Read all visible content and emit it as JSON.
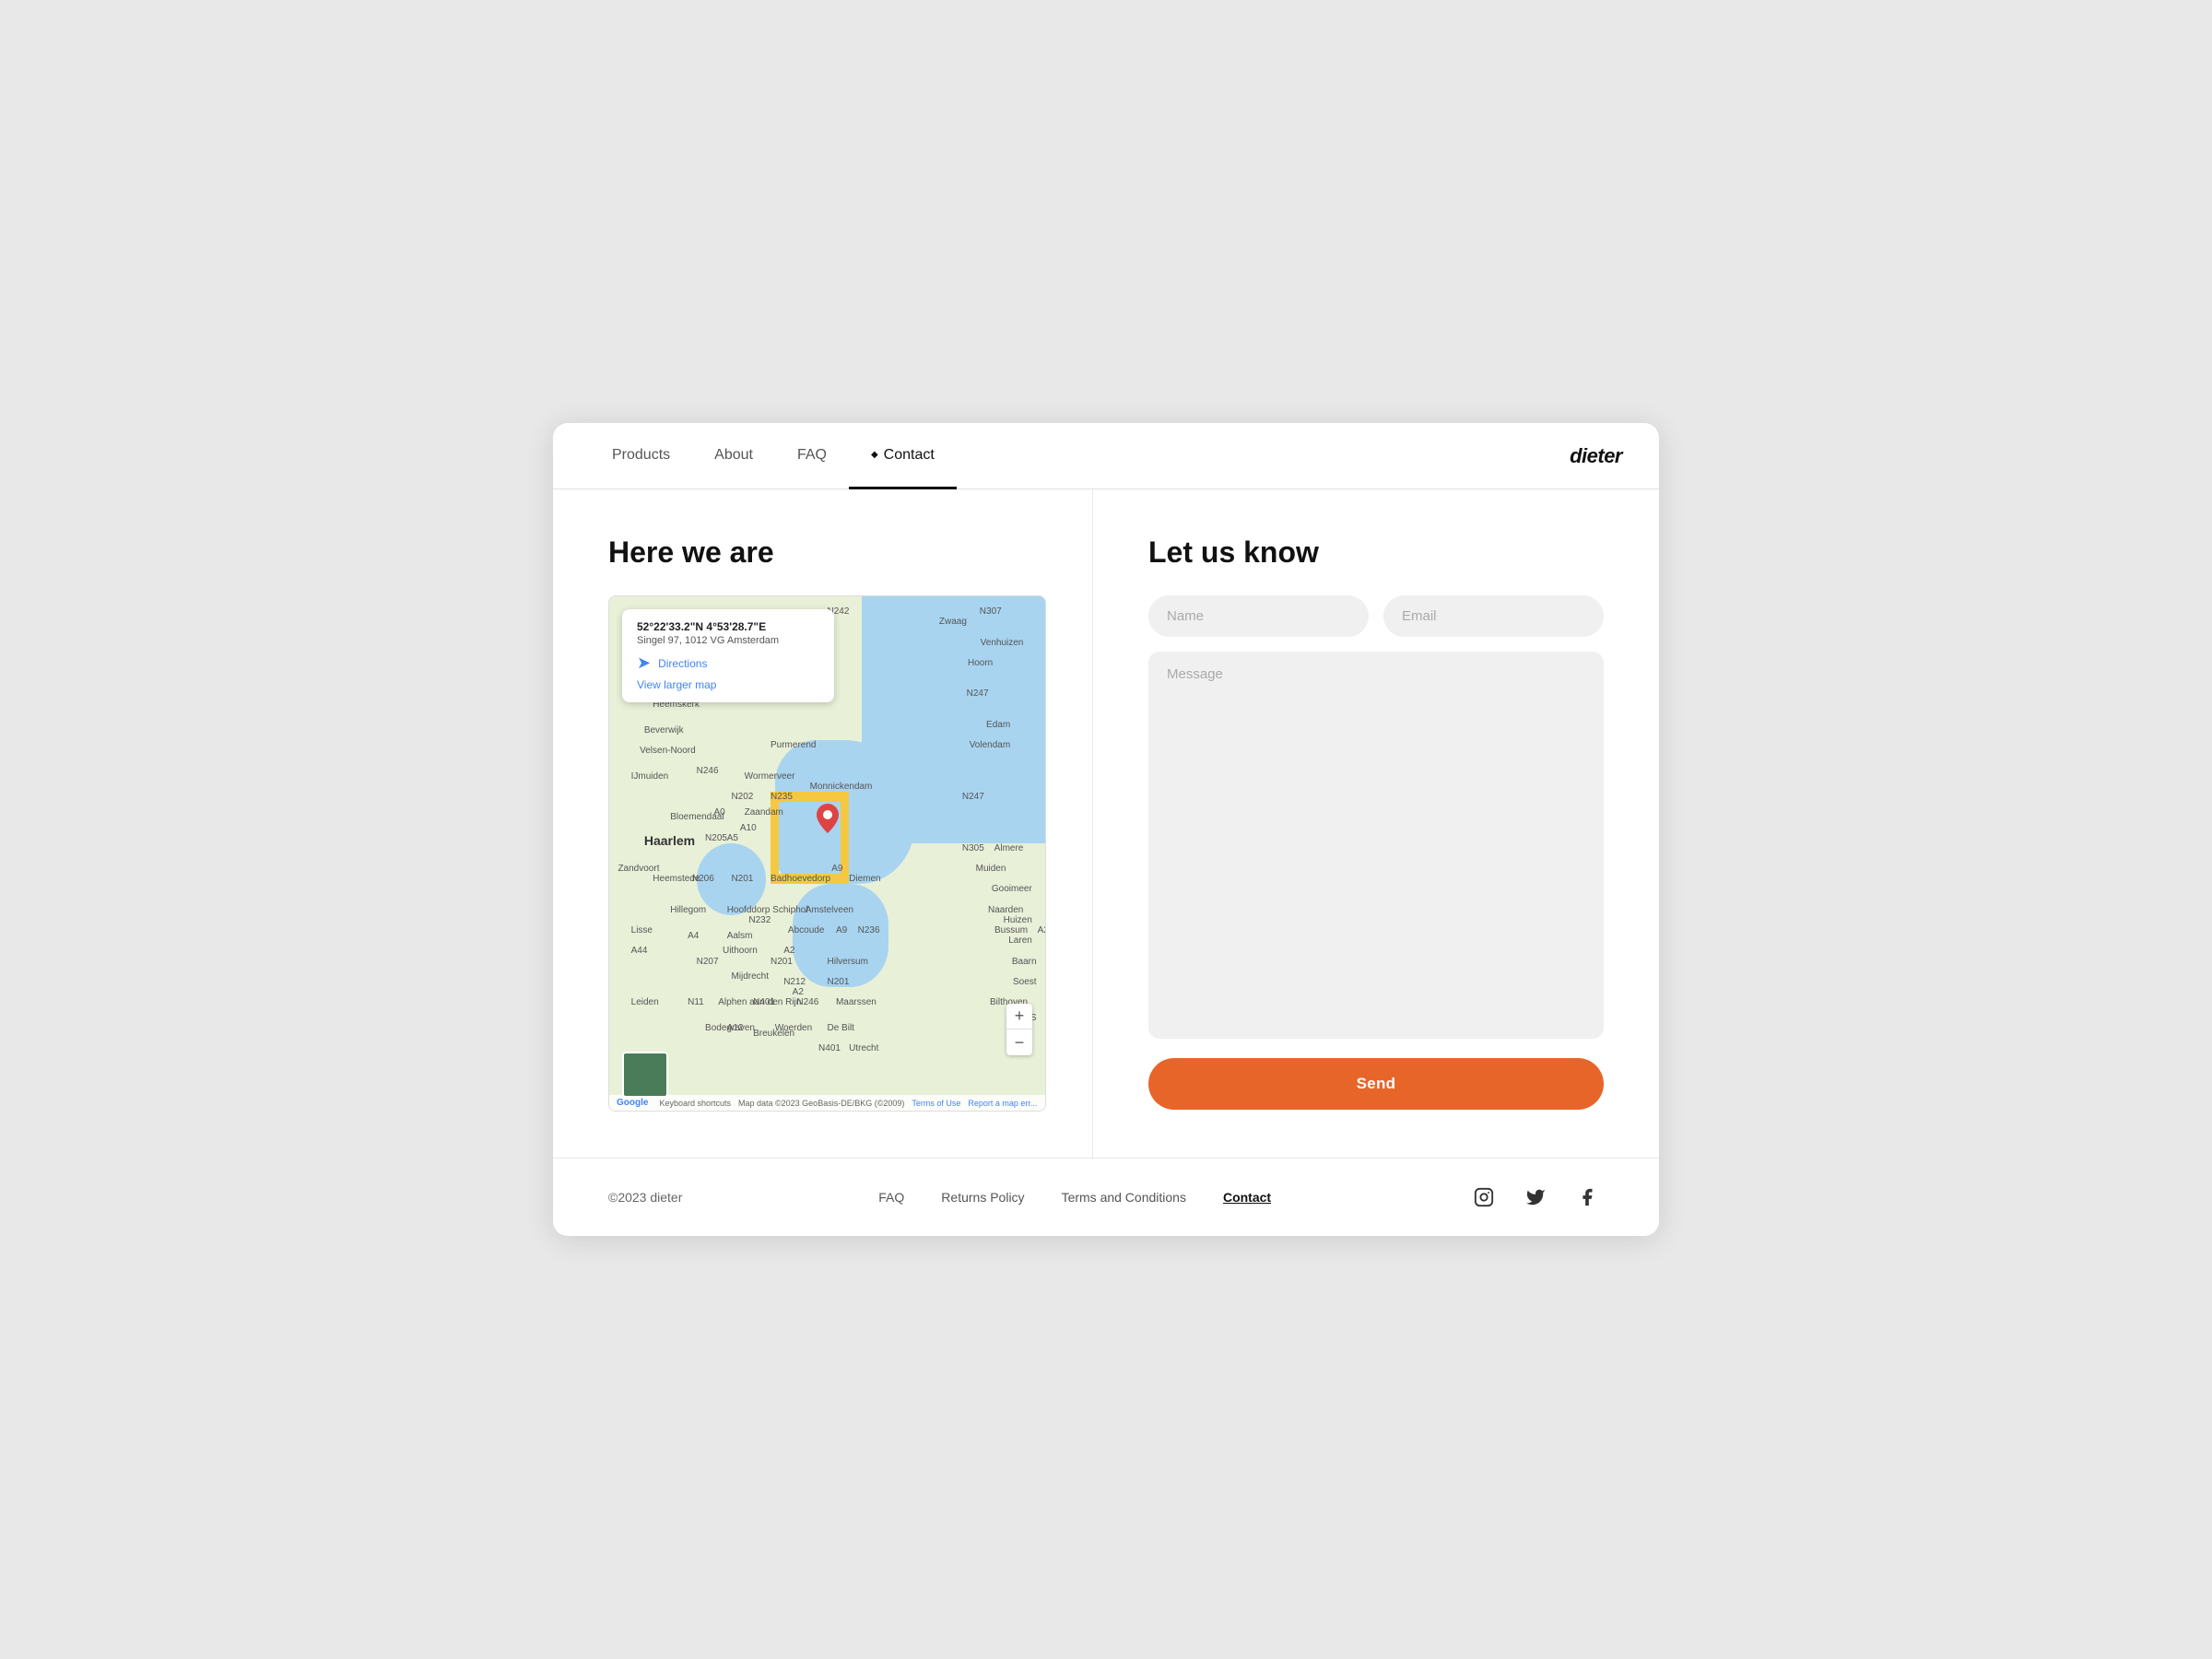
{
  "nav": {
    "items": [
      {
        "label": "Products",
        "active": false
      },
      {
        "label": "About",
        "active": false
      },
      {
        "label": "FAQ",
        "active": false
      },
      {
        "label": "Contact",
        "active": true,
        "dot": "◆"
      }
    ],
    "logo": "dieter"
  },
  "left": {
    "title": "Here we are",
    "map": {
      "coords": "52°22'33.2\"N 4°53'28.7\"E",
      "address": "Singel 97, 1012 VG Amsterdam",
      "directions_label": "Directions",
      "view_larger_label": "View larger map",
      "zoom_in": "+",
      "zoom_out": "−",
      "footer_keyboard": "Keyboard shortcuts",
      "footer_mapdata": "Map data ©2023 GeoBasis-DE/BKG (©2009)",
      "footer_terms": "Terms of Use",
      "footer_report": "Report a map err..."
    }
  },
  "right": {
    "title": "Let us know",
    "form": {
      "name_placeholder": "Name",
      "email_placeholder": "Email",
      "message_placeholder": "Message",
      "send_label": "Send"
    }
  },
  "footer": {
    "copyright": "©2023 dieter",
    "links": [
      {
        "label": "FAQ",
        "active": false
      },
      {
        "label": "Returns Policy",
        "active": false
      },
      {
        "label": "Terms and Conditions",
        "active": false
      },
      {
        "label": "Contact",
        "active": true
      }
    ],
    "socials": [
      {
        "name": "instagram",
        "icon": "instagram-icon"
      },
      {
        "name": "twitter",
        "icon": "twitter-icon"
      },
      {
        "name": "facebook",
        "icon": "facebook-icon"
      }
    ]
  }
}
